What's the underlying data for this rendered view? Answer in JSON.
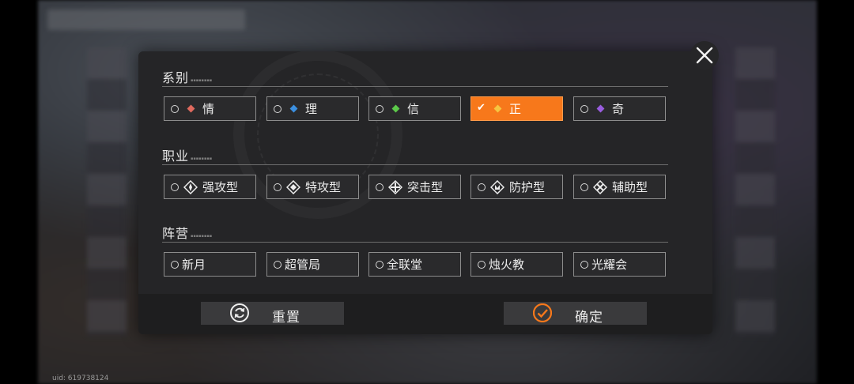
{
  "sections": [
    {
      "title": "系别",
      "options": [
        {
          "label": "情",
          "gem_color": "#e06a5e",
          "selected": false
        },
        {
          "label": "理",
          "gem_color": "#3b8fe0",
          "selected": false
        },
        {
          "label": "信",
          "gem_color": "#5cc94a",
          "selected": false
        },
        {
          "label": "正",
          "gem_color": "#f5c542",
          "selected": true
        },
        {
          "label": "奇",
          "gem_color": "#9a5de0",
          "selected": false
        }
      ]
    },
    {
      "title": "职业",
      "options": [
        {
          "label": "强攻型",
          "icon": "assault-class-icon"
        },
        {
          "label": "特攻型",
          "icon": "special-attack-class-icon"
        },
        {
          "label": "突击型",
          "icon": "raid-class-icon"
        },
        {
          "label": "防护型",
          "icon": "guard-class-icon"
        },
        {
          "label": "辅助型",
          "icon": "support-class-icon"
        }
      ]
    },
    {
      "title": "阵营",
      "options": [
        {
          "label": "新月"
        },
        {
          "label": "超管局"
        },
        {
          "label": "全联堂"
        },
        {
          "label": "烛火教"
        },
        {
          "label": "光耀会"
        }
      ]
    }
  ],
  "footer": {
    "reset_label": "重置",
    "confirm_label": "确定",
    "accent_color": "#f7781b"
  },
  "uid": "uid: 619738124"
}
